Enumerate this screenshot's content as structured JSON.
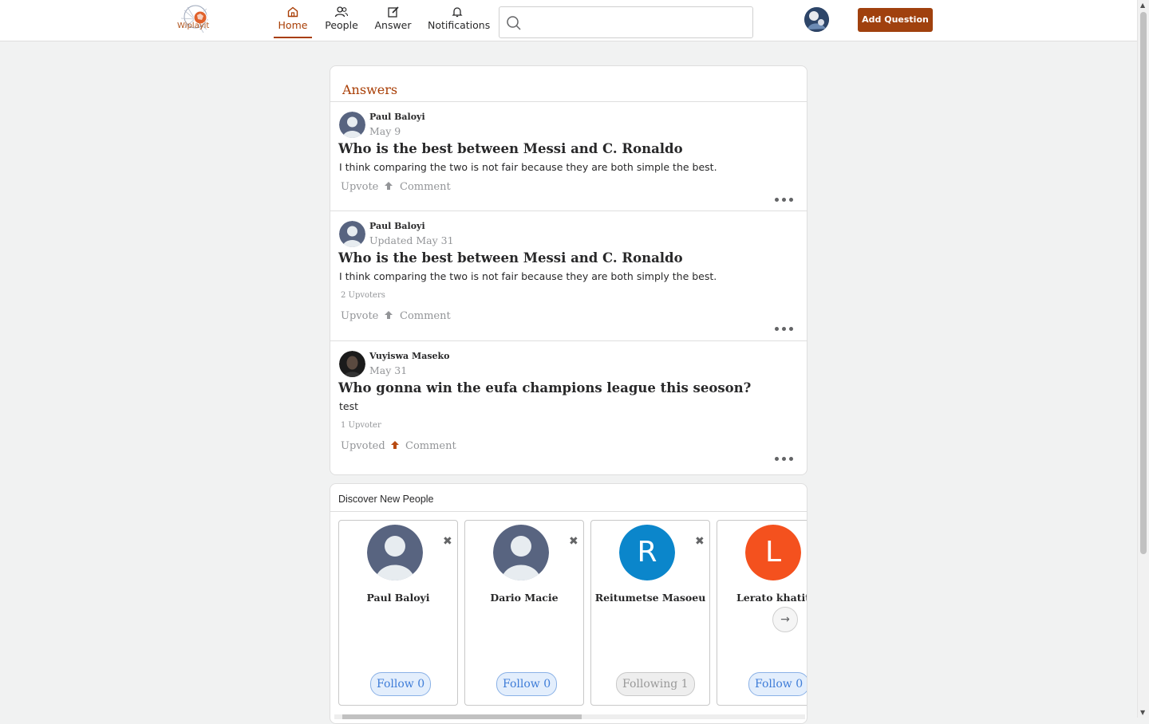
{
  "app": {
    "logo_text": "Wiplayit"
  },
  "nav": {
    "home": "Home",
    "people": "People",
    "answer": "Answer",
    "notifications": "Notifications"
  },
  "search": {
    "placeholder": ""
  },
  "header": {
    "add_question": "Add Question"
  },
  "answers": {
    "title": "Answers",
    "posts": [
      {
        "author": "Paul Baloyi",
        "date": "May 9",
        "question": "Who is the best between Messi and C. Ronaldo",
        "body": "I think comparing the two is not fair because they are both simple the best.",
        "upvoters": "",
        "upvote_label": "Upvote",
        "comment_label": "Comment"
      },
      {
        "author": "Paul Baloyi",
        "date": "Updated May 31",
        "question": "Who is the best between Messi and C. Ronaldo",
        "body": "I think comparing the two is not fair because they are both simply the best.",
        "upvoters": "2 Upvoters",
        "upvote_label": "Upvote",
        "comment_label": "Comment"
      },
      {
        "author": "Vuyiswa Maseko",
        "date": "May 31",
        "question": "Who gonna win the eufa champions league this seoson?",
        "body": "test",
        "upvoters": "1 Upvoter",
        "upvote_label": "Upvoted",
        "comment_label": "Comment"
      }
    ]
  },
  "discover": {
    "title": "Discover New People",
    "people": [
      {
        "name": "Paul Baloyi",
        "follow": "Follow 0"
      },
      {
        "name": "Dario Macie",
        "follow": "Follow 0"
      },
      {
        "name": "Reitumetse Masoeu",
        "initial": "R",
        "color": "#0b86cb",
        "follow": "Following 1"
      },
      {
        "name": "Lerato khatite",
        "initial": "L",
        "color": "#f4511e",
        "follow": "Follow 0"
      }
    ]
  },
  "colors": {
    "brand": "#a83d04",
    "button": "#a0410e"
  }
}
